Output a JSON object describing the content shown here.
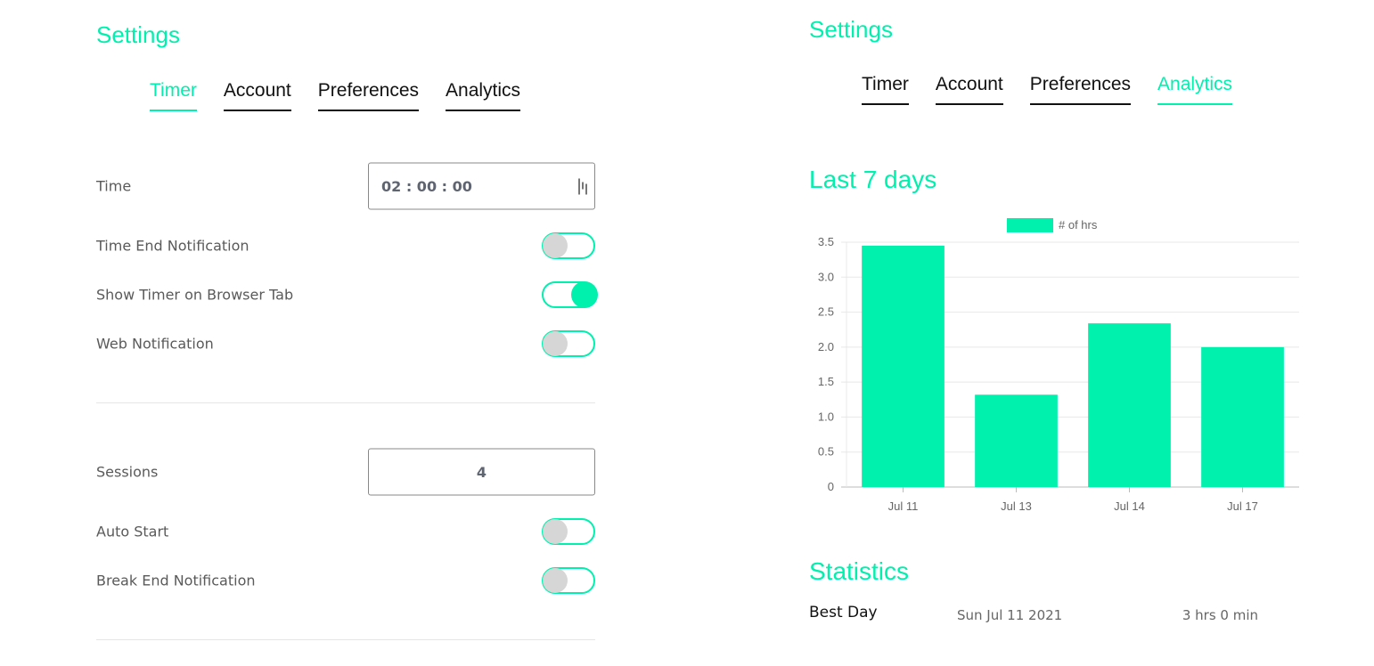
{
  "left": {
    "title": "Settings",
    "tabs": [
      {
        "label": "Timer",
        "active": true
      },
      {
        "label": "Account",
        "active": false
      },
      {
        "label": "Preferences",
        "active": false
      },
      {
        "label": "Analytics",
        "active": false
      }
    ],
    "timer": {
      "time_label": "Time",
      "time_value": "02 : 00 : 00",
      "time_end_notification_label": "Time End Notification",
      "time_end_notification_on": false,
      "show_timer_tab_label": "Show Timer on Browser Tab",
      "show_timer_tab_on": true,
      "web_notification_label": "Web Notification",
      "web_notification_on": false
    },
    "sessions": {
      "sessions_label": "Sessions",
      "sessions_value": "4",
      "auto_start_label": "Auto Start",
      "auto_start_on": false,
      "break_end_notification_label": "Break End Notification",
      "break_end_notification_on": false
    }
  },
  "right": {
    "title": "Settings",
    "tabs": [
      {
        "label": "Timer",
        "active": false
      },
      {
        "label": "Account",
        "active": false
      },
      {
        "label": "Preferences",
        "active": false
      },
      {
        "label": "Analytics",
        "active": true
      }
    ],
    "last7_title": "Last 7 days",
    "statistics_title": "Statistics",
    "best_day_label": "Best Day",
    "best_day_date": "Sun Jul 11 2021",
    "best_day_value": "3 hrs 0 min"
  },
  "colors": {
    "accent": "#00f0ad",
    "text_dark": "#111111",
    "text_muted": "#5a5a5a",
    "toggle_off_knob": "#d6d6d6"
  },
  "icons": {
    "time_input_icon": "time-picker-icon"
  },
  "chart_data": {
    "type": "bar",
    "categories": [
      "Jul 11",
      "Jul 13",
      "Jul 14",
      "Jul 17"
    ],
    "series": [
      {
        "name": "# of hrs",
        "values": [
          3.45,
          1.32,
          2.34,
          2.0
        ]
      }
    ],
    "ylim": [
      0,
      3.5
    ],
    "yticks": [
      "0",
      "0.5",
      "1.0",
      "1.5",
      "2.0",
      "2.5",
      "3.0",
      "3.5"
    ],
    "grid": true,
    "legend": "top-center",
    "color": "#00f0ad"
  }
}
